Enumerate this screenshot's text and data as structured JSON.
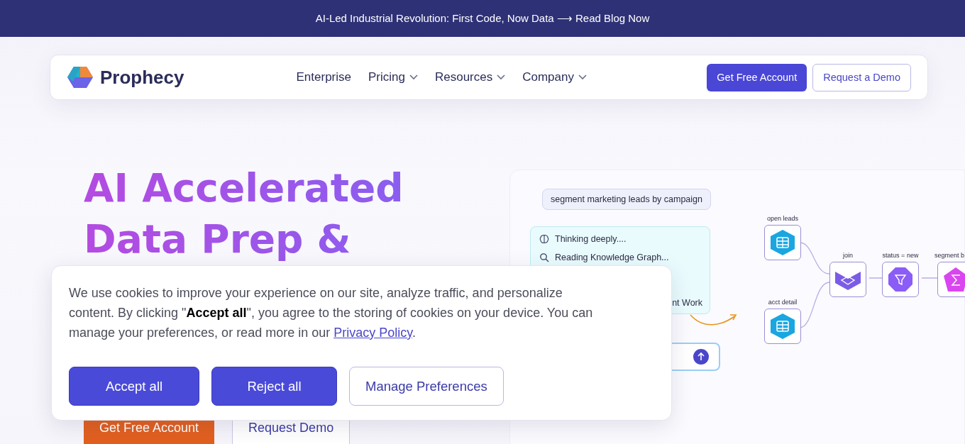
{
  "announcement": {
    "text": "AI-Led Industrial Revolution: First Code, Now Data",
    "arrow": "⟶",
    "link": "Read Blog Now"
  },
  "nav": {
    "brand": "Prophecy",
    "items": [
      {
        "label": "Enterprise",
        "dropdown": false
      },
      {
        "label": "Pricing",
        "dropdown": true
      },
      {
        "label": "Resources",
        "dropdown": true
      },
      {
        "label": "Company",
        "dropdown": true
      }
    ],
    "primary_button": "Get Free Account",
    "secondary_button": "Request a Demo"
  },
  "hero": {
    "heading_lines": [
      "AI Accelerated",
      "Data Prep &"
    ],
    "buttons": [
      {
        "label": "Get Free Account",
        "kind": "primary"
      },
      {
        "label": "Request Demo",
        "kind": "secondary"
      }
    ]
  },
  "demo": {
    "prompt": "segment marketing leads by campaign",
    "steps": [
      {
        "label": "Thinking deeply....",
        "kind": "think"
      },
      {
        "label": "Reading Knowledge Graph...",
        "kind": "search"
      }
    ],
    "step_footer": "nt Work",
    "nodes": [
      {
        "label": "open leads",
        "kind": "table"
      },
      {
        "label": "acct detail",
        "kind": "table"
      },
      {
        "label": "join",
        "kind": "join"
      },
      {
        "label": "status = new",
        "kind": "filter"
      },
      {
        "label": "segment b",
        "kind": "aggregate"
      }
    ]
  },
  "cookie": {
    "text": "We use cookies to improve your experience on our site, analyze traffic, and personalize content. By clicking \"**Accept all**\", you agree to the storing of cookies on your device. You can manage your preferences, or read more in our ",
    "link": "Privacy Policy",
    "end": ".",
    "buttons": [
      {
        "label": "Accept all",
        "kind": "primary"
      },
      {
        "label": "Reject all",
        "kind": "primary"
      },
      {
        "label": "Manage Preferences",
        "kind": "outline"
      }
    ]
  }
}
